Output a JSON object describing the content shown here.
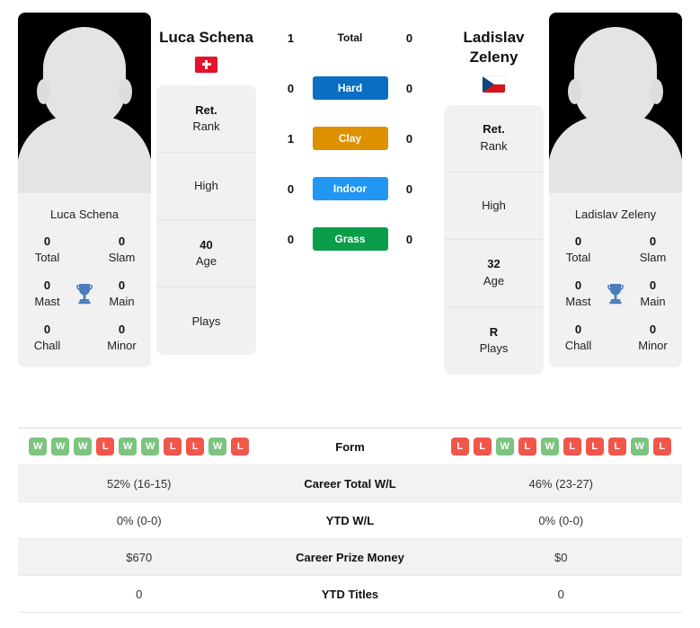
{
  "players": {
    "left": {
      "name": "Luca Schena",
      "photo_label": "Luca Schena",
      "flag": "switzerland-flag",
      "titles": [
        {
          "value": "0",
          "label": "Total"
        },
        {
          "value": "0",
          "label": "Slam"
        },
        {
          "value": "0",
          "label": "Mast"
        },
        {
          "value": "0",
          "label": "Main"
        },
        {
          "value": "0",
          "label": "Chall"
        },
        {
          "value": "0",
          "label": "Minor"
        }
      ],
      "info": [
        {
          "value": "Ret.",
          "label": "Rank"
        },
        {
          "value": "",
          "label": "High"
        },
        {
          "value": "40",
          "label": "Age"
        },
        {
          "value": "",
          "label": "Plays"
        }
      ],
      "form": [
        "W",
        "W",
        "W",
        "L",
        "W",
        "W",
        "L",
        "L",
        "W",
        "L"
      ],
      "career_total_wl": "52% (16-15)",
      "ytd_wl": "0% (0-0)",
      "career_prize_money": "$670",
      "ytd_titles": "0"
    },
    "right": {
      "name": "Ladislav Zeleny",
      "photo_label": "Ladislav Zeleny",
      "flag": "czech-republic-flag",
      "titles": [
        {
          "value": "0",
          "label": "Total"
        },
        {
          "value": "0",
          "label": "Slam"
        },
        {
          "value": "0",
          "label": "Mast"
        },
        {
          "value": "0",
          "label": "Main"
        },
        {
          "value": "0",
          "label": "Chall"
        },
        {
          "value": "0",
          "label": "Minor"
        }
      ],
      "info": [
        {
          "value": "Ret.",
          "label": "Rank"
        },
        {
          "value": "",
          "label": "High"
        },
        {
          "value": "32",
          "label": "Age"
        },
        {
          "value": "R",
          "label": "Plays"
        }
      ],
      "form": [
        "L",
        "L",
        "W",
        "L",
        "W",
        "L",
        "L",
        "L",
        "W",
        "L"
      ],
      "career_total_wl": "46% (23-27)",
      "ytd_wl": "0% (0-0)",
      "career_prize_money": "$0",
      "ytd_titles": "0"
    }
  },
  "surfaces": [
    {
      "label": "Total",
      "left": "1",
      "right": "0",
      "color": ""
    },
    {
      "label": "Hard",
      "left": "0",
      "right": "0",
      "color": "#0a6fc2"
    },
    {
      "label": "Clay",
      "left": "1",
      "right": "0",
      "color": "#dd9000"
    },
    {
      "label": "Indoor",
      "left": "0",
      "right": "0",
      "color": "#2196f3"
    },
    {
      "label": "Grass",
      "left": "0",
      "right": "0",
      "color": "#0a9d4a"
    }
  ],
  "table": {
    "rows": [
      {
        "label": "Form",
        "type": "form"
      },
      {
        "label": "Career Total W/L",
        "type": "text",
        "left": "52% (16-15)",
        "right": "46% (23-27)"
      },
      {
        "label": "YTD W/L",
        "type": "text",
        "left": "0% (0-0)",
        "right": "0% (0-0)"
      },
      {
        "label": "Career Prize Money",
        "type": "text",
        "left": "$670",
        "right": "$0"
      },
      {
        "label": "YTD Titles",
        "type": "text",
        "left": "0",
        "right": "0"
      }
    ]
  },
  "colors": {
    "form_win": "#7cc47f",
    "form_loss": "#f0574a",
    "trophy": "#4a7dba",
    "card_bg": "#f1f1f1"
  }
}
